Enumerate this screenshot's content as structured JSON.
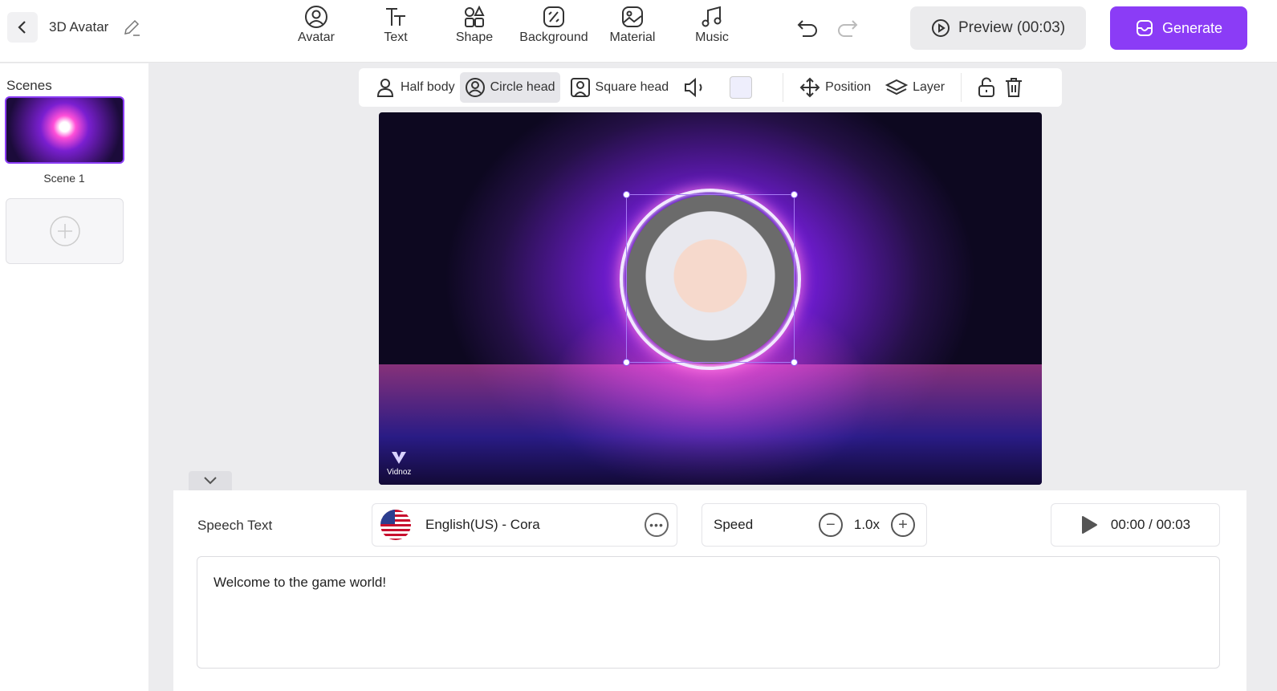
{
  "header": {
    "title": "3D Avatar",
    "tools": [
      {
        "label": "Avatar",
        "icon": "avatar-icon"
      },
      {
        "label": "Text",
        "icon": "text-icon"
      },
      {
        "label": "Shape",
        "icon": "shape-icon"
      },
      {
        "label": "Background",
        "icon": "background-icon"
      },
      {
        "label": "Material",
        "icon": "material-icon"
      },
      {
        "label": "Music",
        "icon": "music-icon"
      }
    ],
    "preview_label": "Preview (00:03)",
    "generate_label": "Generate",
    "accent": "#8b3cf6"
  },
  "sidebar": {
    "label": "Scenes",
    "scenes": [
      {
        "label": "Scene 1"
      }
    ]
  },
  "toolbar": {
    "half_body": "Half body",
    "circle_head": "Circle head",
    "square_head": "Square head",
    "position": "Position",
    "layer": "Layer",
    "selected": "Circle head"
  },
  "canvas": {
    "watermark": "Vidnoz"
  },
  "speech": {
    "label": "Speech Text",
    "voice": "English(US) - Cora",
    "speed_label": "Speed",
    "speed": "1.0x",
    "time": "00:00 / 00:03",
    "text": "Welcome to the game world!"
  }
}
